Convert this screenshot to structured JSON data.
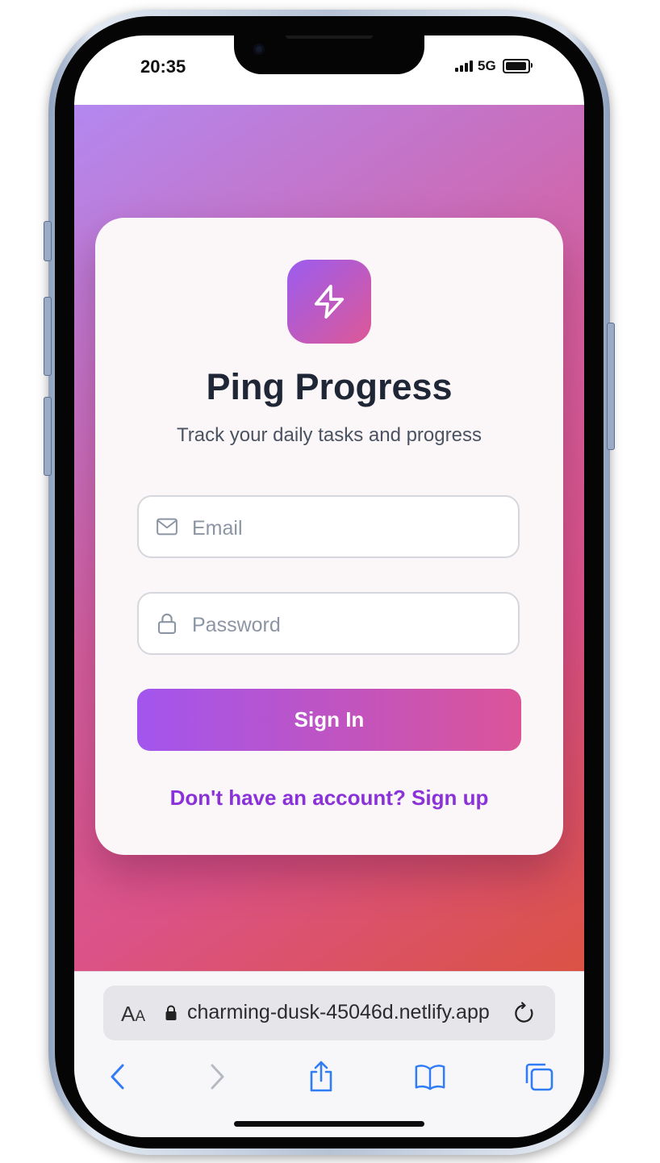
{
  "status_bar": {
    "time": "20:35",
    "network": "5G"
  },
  "app": {
    "title": "Ping Progress",
    "subtitle": "Track your daily tasks and progress",
    "logo_icon": "lightning-icon"
  },
  "form": {
    "email": {
      "value": "",
      "placeholder": "Email",
      "icon": "mail-icon"
    },
    "password": {
      "value": "",
      "placeholder": "Password",
      "icon": "lock-icon"
    },
    "submit_label": "Sign In",
    "signup_link": "Don't have an account? Sign up"
  },
  "browser": {
    "text_size_label": "A",
    "text_size_label_small": "A",
    "url": "charming-dusk-45046d.netlify.app",
    "toolbar": [
      "back-icon",
      "forward-icon",
      "share-icon",
      "bookmarks-icon",
      "tabs-icon"
    ]
  },
  "colors": {
    "background_start": "#b388f0",
    "background_end": "#db5244",
    "accent_start": "#9b5cf0",
    "accent_end": "#dd5896",
    "link": "#8a32d8",
    "title_text": "#1f2737",
    "browser_link_blue": "#2f7cf6"
  }
}
